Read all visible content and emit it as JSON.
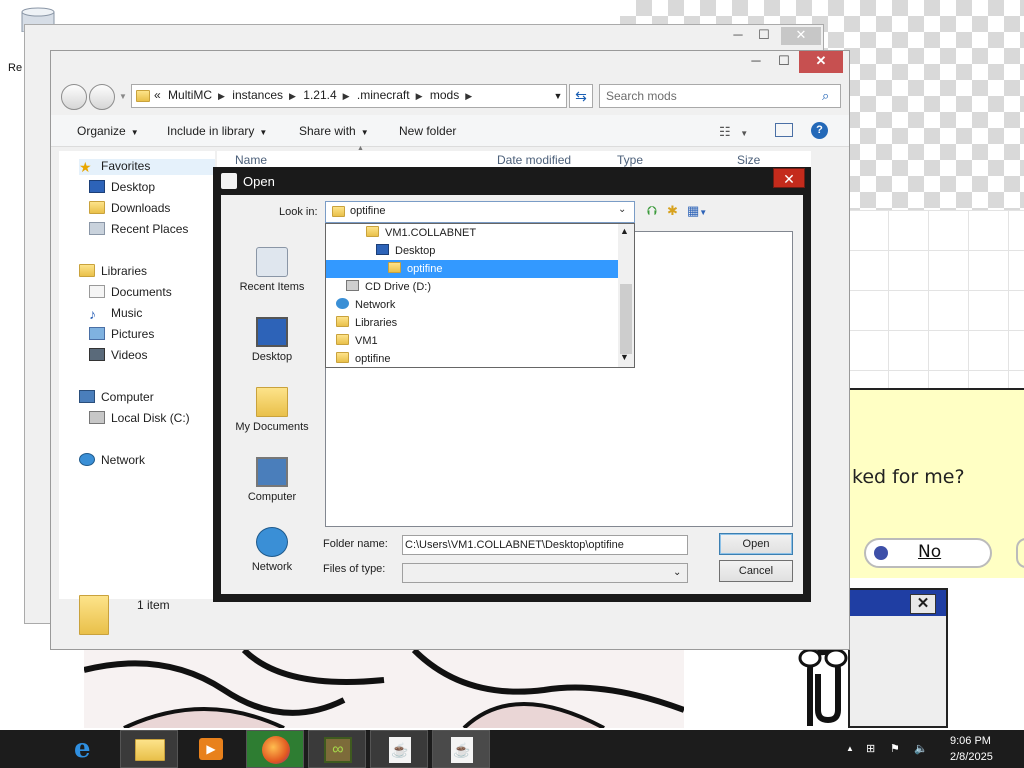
{
  "explorer": {
    "breadcrumbs": [
      "MultiMC",
      "instances",
      "1.21.4",
      ".minecraft",
      "mods"
    ],
    "breadcrumb_prefix": "«",
    "search_placeholder": "Search mods",
    "toolbar": {
      "organize": "Organize",
      "include": "Include in library",
      "share": "Share with",
      "new_folder": "New folder"
    },
    "columns": [
      "Name",
      "Date modified",
      "Type",
      "Size"
    ],
    "nav": {
      "favorites": "Favorites",
      "desktop": "Desktop",
      "downloads": "Downloads",
      "recent": "Recent Places",
      "libraries": "Libraries",
      "documents": "Documents",
      "music": "Music",
      "pictures": "Pictures",
      "videos": "Videos",
      "computer": "Computer",
      "local_disk": "Local Disk (C:)",
      "network": "Network"
    },
    "status_count": "1 item"
  },
  "dialog": {
    "title": "Open",
    "look_in_label": "Look in:",
    "look_in_value": "optifine",
    "dropdown_items": [
      {
        "label": "VM1.COLLABNET",
        "icon": "folder-icon",
        "indent": 2
      },
      {
        "label": "Desktop",
        "icon": "desktop-icon",
        "indent": 3
      },
      {
        "label": "optifine",
        "icon": "folder-icon",
        "indent": 4,
        "selected": true
      },
      {
        "label": "CD Drive (D:)",
        "icon": "cd-drive-icon",
        "indent": 1
      },
      {
        "label": "Network",
        "icon": "network-icon",
        "indent": 0
      },
      {
        "label": "Libraries",
        "icon": "libraries-icon",
        "indent": 0
      },
      {
        "label": "VM1",
        "icon": "user-folder-icon",
        "indent": 0
      },
      {
        "label": "optifine",
        "icon": "folder-icon",
        "indent": 0
      }
    ],
    "places": [
      "Recent Items",
      "Desktop",
      "My Documents",
      "Computer",
      "Network"
    ],
    "folder_name_label": "Folder name:",
    "folder_name_value": "C:\\Users\\VM1.COLLABNET\\Desktop\\optifine",
    "files_of_type_label": "Files of type:",
    "files_of_type_value": "",
    "open_button": "Open",
    "cancel_button": "Cancel"
  },
  "background": {
    "message_fragment": "ked for me?",
    "no_button": "No"
  },
  "taskbar": {
    "time": "9:06 PM",
    "date": "2/8/2025",
    "apps": [
      "internet-explorer-icon",
      "file-explorer-icon",
      "media-player-icon",
      "firefox-icon",
      "multimc-icon",
      "java-icon",
      "java-icon"
    ]
  },
  "colors": {
    "selection": "#3399ff",
    "close_red": "#c42b1c",
    "taskbar": "#1c1c1c"
  }
}
